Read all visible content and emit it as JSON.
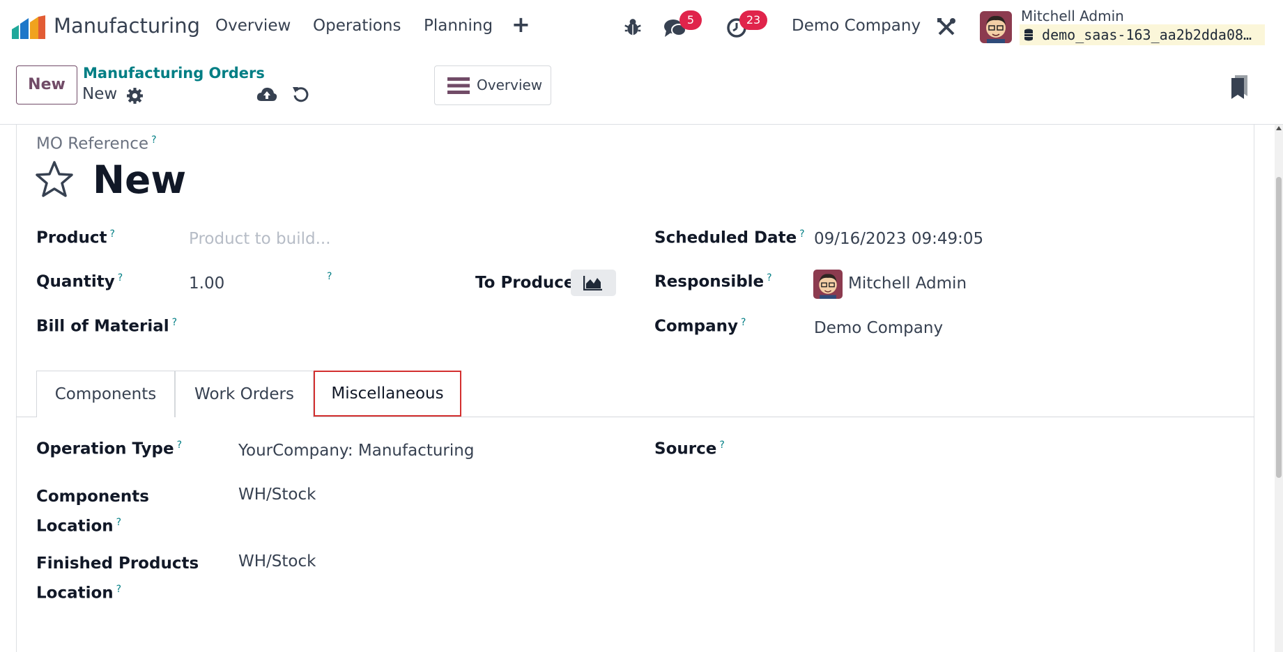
{
  "navbar": {
    "app_name": "Manufacturing",
    "menu": [
      "Overview",
      "Operations",
      "Planning"
    ],
    "messages_count": "5",
    "activities_count": "23",
    "company": "Demo Company",
    "user_name": "Mitchell Admin",
    "database": "demo_saas-163_aa2b2dda08…"
  },
  "control_panel": {
    "new_label": "New",
    "breadcrumb": "Manufacturing Orders",
    "record_name": "New",
    "view_label": "Overview"
  },
  "form": {
    "reference_label": "MO Reference",
    "title": "New",
    "product_label": "Product",
    "product_placeholder": "Product to build...",
    "quantity_label": "Quantity",
    "quantity_value": "1.00",
    "to_produce_label": "To Produce",
    "bom_label": "Bill of Material",
    "scheduled_date_label": "Scheduled Date",
    "scheduled_date_value": "09/16/2023 09:49:05",
    "responsible_label": "Responsible",
    "responsible_value": "Mitchell Admin",
    "company_label": "Company",
    "company_value": "Demo Company",
    "help_mark": "?"
  },
  "tabs": [
    "Components",
    "Work Orders",
    "Miscellaneous"
  ],
  "misc": {
    "operation_type_label": "Operation Type",
    "operation_type_value": "YourCompany: Manufacturing",
    "components_location_label_1": "Components",
    "components_location_label_2": "Location",
    "components_location_value": "WH/Stock",
    "finished_location_label_1": "Finished Products",
    "finished_location_label_2": "Location",
    "finished_location_value": "WH/Stock",
    "source_label": "Source"
  },
  "colors": {
    "brand": "#714b67",
    "link": "#017e84",
    "badge": "#e0244b",
    "active_tab_border": "#d32f2f"
  },
  "icons": [
    "app-logo-icon",
    "plus-icon",
    "bug-icon",
    "chat-icon",
    "clock-icon",
    "tools-icon",
    "database-icon",
    "gear-icon",
    "cloud-upload-icon",
    "undo-icon",
    "hamburger-icon",
    "bookmark-icon",
    "star-icon",
    "area-chart-icon"
  ]
}
